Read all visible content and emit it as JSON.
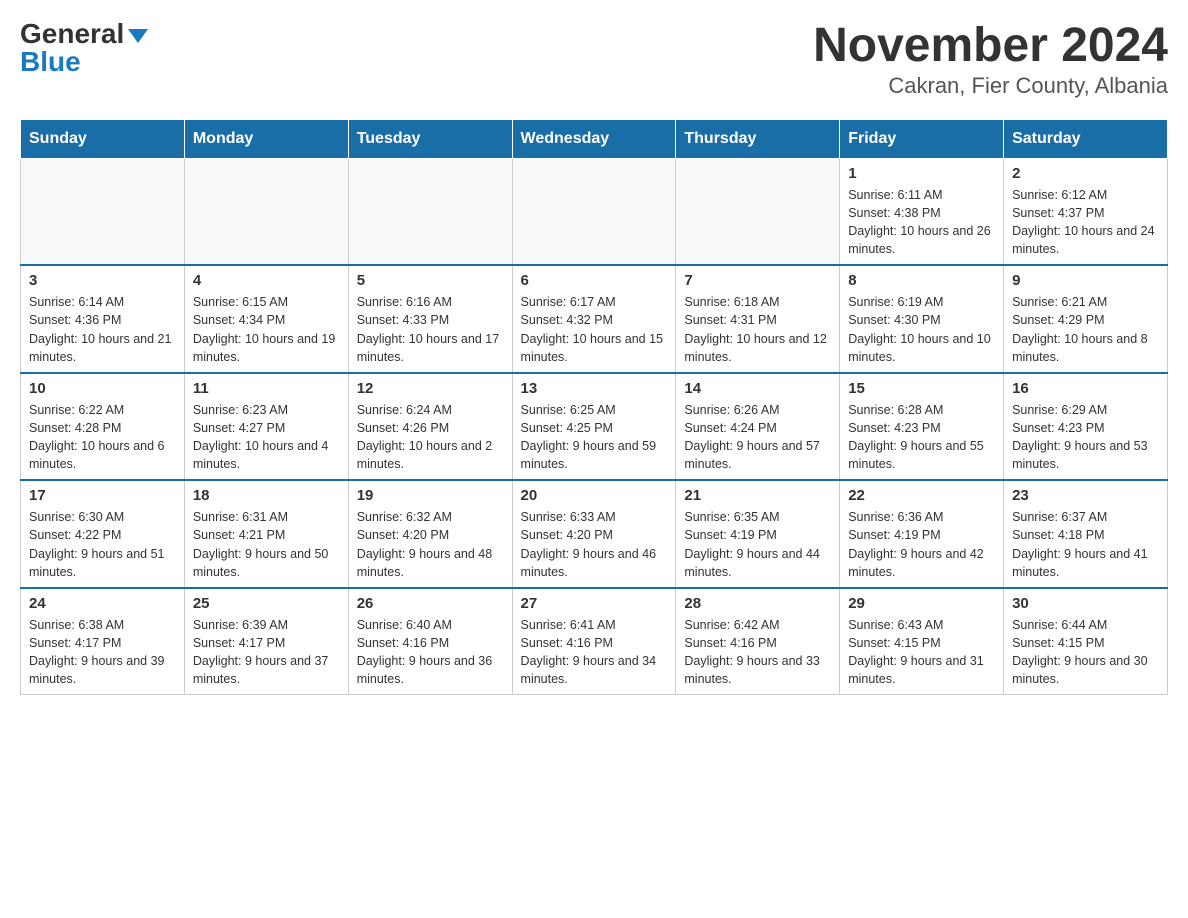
{
  "logo": {
    "general": "General",
    "blue": "Blue"
  },
  "title": "November 2024",
  "location": "Cakran, Fier County, Albania",
  "days_of_week": [
    "Sunday",
    "Monday",
    "Tuesday",
    "Wednesday",
    "Thursday",
    "Friday",
    "Saturday"
  ],
  "weeks": [
    [
      {
        "day": "",
        "info": ""
      },
      {
        "day": "",
        "info": ""
      },
      {
        "day": "",
        "info": ""
      },
      {
        "day": "",
        "info": ""
      },
      {
        "day": "",
        "info": ""
      },
      {
        "day": "1",
        "info": "Sunrise: 6:11 AM\nSunset: 4:38 PM\nDaylight: 10 hours and 26 minutes."
      },
      {
        "day": "2",
        "info": "Sunrise: 6:12 AM\nSunset: 4:37 PM\nDaylight: 10 hours and 24 minutes."
      }
    ],
    [
      {
        "day": "3",
        "info": "Sunrise: 6:14 AM\nSunset: 4:36 PM\nDaylight: 10 hours and 21 minutes."
      },
      {
        "day": "4",
        "info": "Sunrise: 6:15 AM\nSunset: 4:34 PM\nDaylight: 10 hours and 19 minutes."
      },
      {
        "day": "5",
        "info": "Sunrise: 6:16 AM\nSunset: 4:33 PM\nDaylight: 10 hours and 17 minutes."
      },
      {
        "day": "6",
        "info": "Sunrise: 6:17 AM\nSunset: 4:32 PM\nDaylight: 10 hours and 15 minutes."
      },
      {
        "day": "7",
        "info": "Sunrise: 6:18 AM\nSunset: 4:31 PM\nDaylight: 10 hours and 12 minutes."
      },
      {
        "day": "8",
        "info": "Sunrise: 6:19 AM\nSunset: 4:30 PM\nDaylight: 10 hours and 10 minutes."
      },
      {
        "day": "9",
        "info": "Sunrise: 6:21 AM\nSunset: 4:29 PM\nDaylight: 10 hours and 8 minutes."
      }
    ],
    [
      {
        "day": "10",
        "info": "Sunrise: 6:22 AM\nSunset: 4:28 PM\nDaylight: 10 hours and 6 minutes."
      },
      {
        "day": "11",
        "info": "Sunrise: 6:23 AM\nSunset: 4:27 PM\nDaylight: 10 hours and 4 minutes."
      },
      {
        "day": "12",
        "info": "Sunrise: 6:24 AM\nSunset: 4:26 PM\nDaylight: 10 hours and 2 minutes."
      },
      {
        "day": "13",
        "info": "Sunrise: 6:25 AM\nSunset: 4:25 PM\nDaylight: 9 hours and 59 minutes."
      },
      {
        "day": "14",
        "info": "Sunrise: 6:26 AM\nSunset: 4:24 PM\nDaylight: 9 hours and 57 minutes."
      },
      {
        "day": "15",
        "info": "Sunrise: 6:28 AM\nSunset: 4:23 PM\nDaylight: 9 hours and 55 minutes."
      },
      {
        "day": "16",
        "info": "Sunrise: 6:29 AM\nSunset: 4:23 PM\nDaylight: 9 hours and 53 minutes."
      }
    ],
    [
      {
        "day": "17",
        "info": "Sunrise: 6:30 AM\nSunset: 4:22 PM\nDaylight: 9 hours and 51 minutes."
      },
      {
        "day": "18",
        "info": "Sunrise: 6:31 AM\nSunset: 4:21 PM\nDaylight: 9 hours and 50 minutes."
      },
      {
        "day": "19",
        "info": "Sunrise: 6:32 AM\nSunset: 4:20 PM\nDaylight: 9 hours and 48 minutes."
      },
      {
        "day": "20",
        "info": "Sunrise: 6:33 AM\nSunset: 4:20 PM\nDaylight: 9 hours and 46 minutes."
      },
      {
        "day": "21",
        "info": "Sunrise: 6:35 AM\nSunset: 4:19 PM\nDaylight: 9 hours and 44 minutes."
      },
      {
        "day": "22",
        "info": "Sunrise: 6:36 AM\nSunset: 4:19 PM\nDaylight: 9 hours and 42 minutes."
      },
      {
        "day": "23",
        "info": "Sunrise: 6:37 AM\nSunset: 4:18 PM\nDaylight: 9 hours and 41 minutes."
      }
    ],
    [
      {
        "day": "24",
        "info": "Sunrise: 6:38 AM\nSunset: 4:17 PM\nDaylight: 9 hours and 39 minutes."
      },
      {
        "day": "25",
        "info": "Sunrise: 6:39 AM\nSunset: 4:17 PM\nDaylight: 9 hours and 37 minutes."
      },
      {
        "day": "26",
        "info": "Sunrise: 6:40 AM\nSunset: 4:16 PM\nDaylight: 9 hours and 36 minutes."
      },
      {
        "day": "27",
        "info": "Sunrise: 6:41 AM\nSunset: 4:16 PM\nDaylight: 9 hours and 34 minutes."
      },
      {
        "day": "28",
        "info": "Sunrise: 6:42 AM\nSunset: 4:16 PM\nDaylight: 9 hours and 33 minutes."
      },
      {
        "day": "29",
        "info": "Sunrise: 6:43 AM\nSunset: 4:15 PM\nDaylight: 9 hours and 31 minutes."
      },
      {
        "day": "30",
        "info": "Sunrise: 6:44 AM\nSunset: 4:15 PM\nDaylight: 9 hours and 30 minutes."
      }
    ]
  ]
}
